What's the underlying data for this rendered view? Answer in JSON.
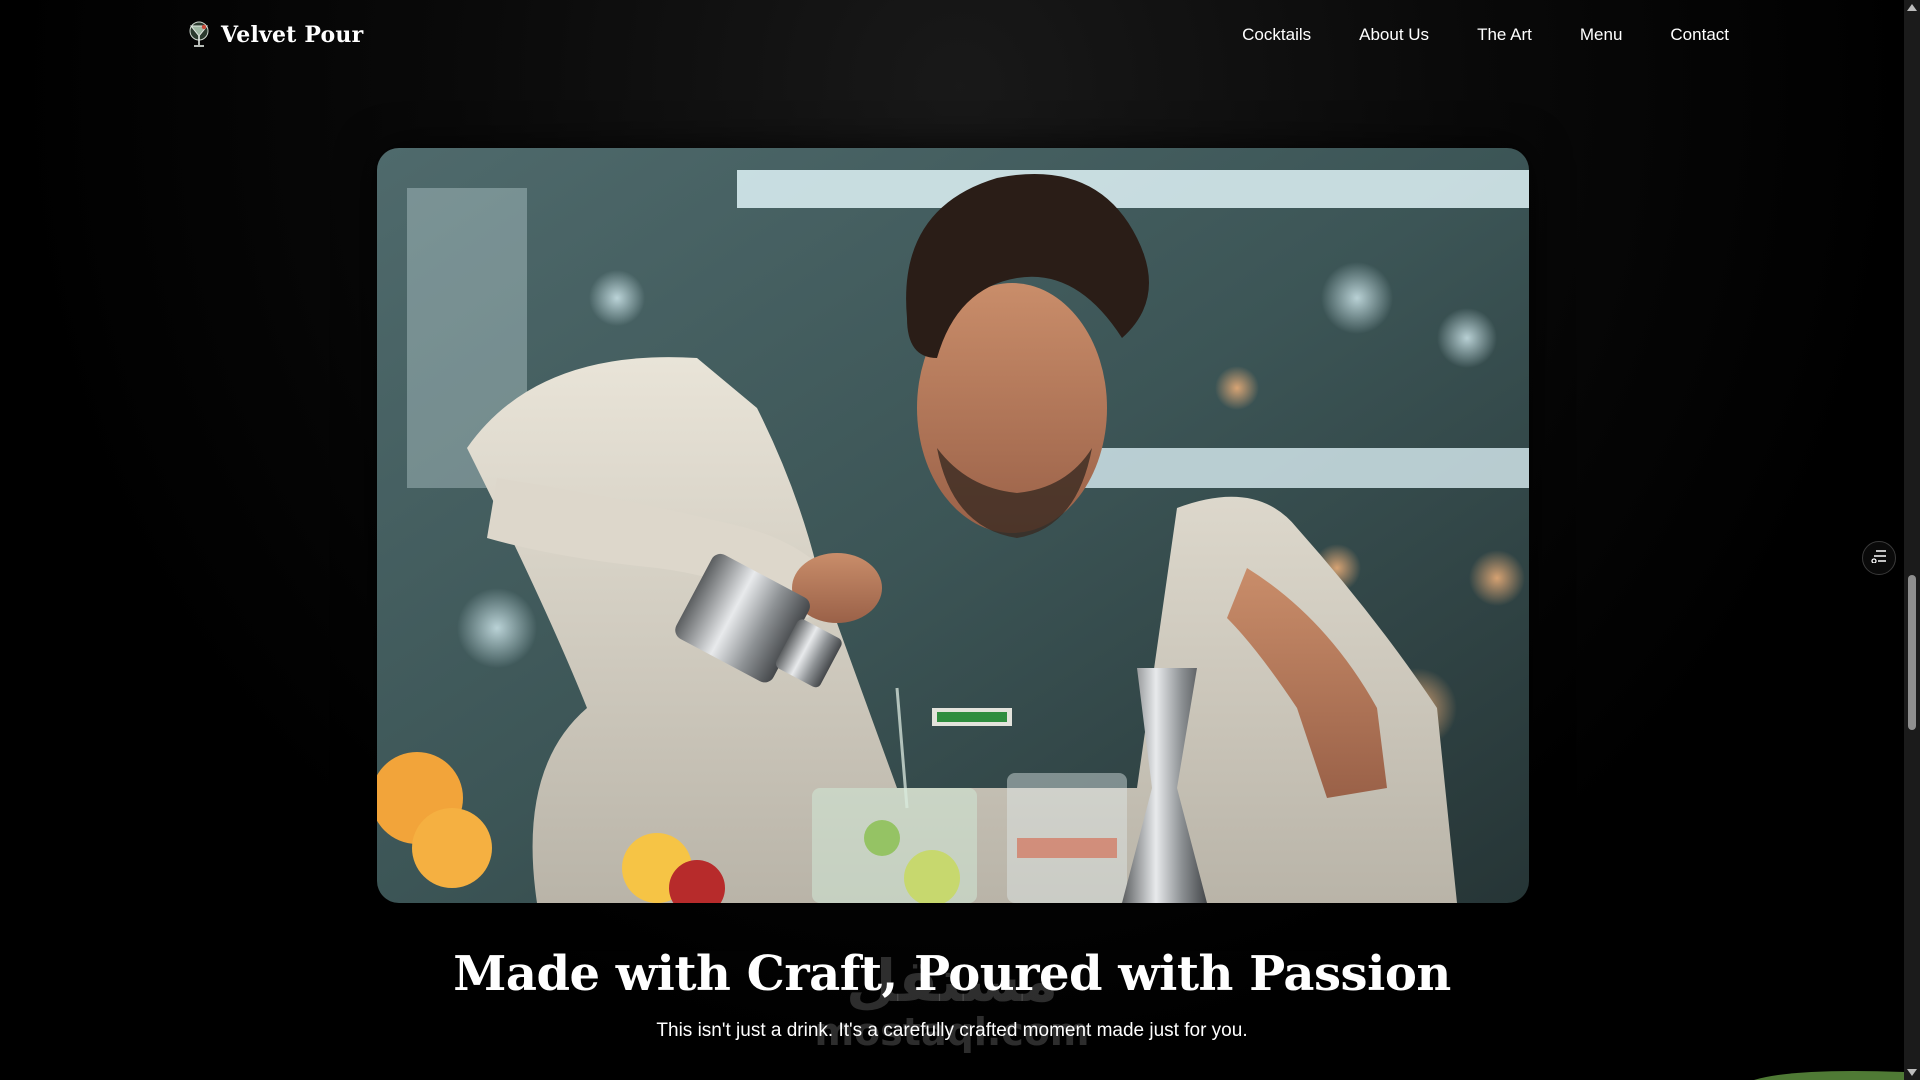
{
  "header": {
    "brand_name": "Velvet Pour",
    "logo_icon": "cocktail-glass-icon",
    "nav": [
      {
        "label": "Cocktails"
      },
      {
        "label": "About Us"
      },
      {
        "label": "The Art"
      },
      {
        "label": "Menu"
      },
      {
        "label": "Contact"
      }
    ]
  },
  "hero": {
    "image": "bartender-pouring-cocktail-photo"
  },
  "section": {
    "title": "Made with Craft, Poured with Passion",
    "subtitle": "This isn't just a drink. It's a carefully crafted moment made just for you."
  },
  "watermark": {
    "main": "مستقل",
    "url": "mostaql.com"
  },
  "floating_button": {
    "icon": "filter-settings-icon"
  },
  "colors": {
    "background": "#000000",
    "text": "#ffffff"
  }
}
